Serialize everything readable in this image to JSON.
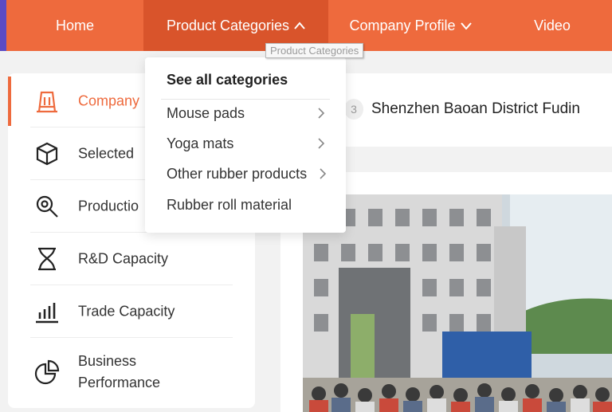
{
  "nav": {
    "items": [
      {
        "label": "Home",
        "chevron": ""
      },
      {
        "label": "Product Categories",
        "chevron": "^"
      },
      {
        "label": "Company Profile",
        "chevron": "v"
      },
      {
        "label": "Video",
        "chevron": ""
      }
    ],
    "tooltip": "Product Categories"
  },
  "sidebar": {
    "items": [
      {
        "label": "Company",
        "icon": "building-icon"
      },
      {
        "label": "Selected",
        "icon": "cube-icon"
      },
      {
        "label": "Productio",
        "icon": "search-gear-icon"
      },
      {
        "label": "R&D Capacity",
        "icon": "dna-icon"
      },
      {
        "label": "Trade Capacity",
        "icon": "bar-chart-icon"
      },
      {
        "label": "Business\nPerformance",
        "icon": "pie-chart-icon"
      }
    ]
  },
  "dropdown": {
    "header": "See all categories",
    "items": [
      {
        "label": "Mouse pads",
        "has_sub": true
      },
      {
        "label": "Yoga mats",
        "has_sub": true
      },
      {
        "label": "Other rubber products",
        "has_sub": true
      },
      {
        "label": "Rubber roll material",
        "has_sub": false
      }
    ]
  },
  "company": {
    "name": "Shenzhen Baoan District Fudin"
  },
  "colors": {
    "accent": "#ee6a3d",
    "nav_active": "#d9542b"
  }
}
